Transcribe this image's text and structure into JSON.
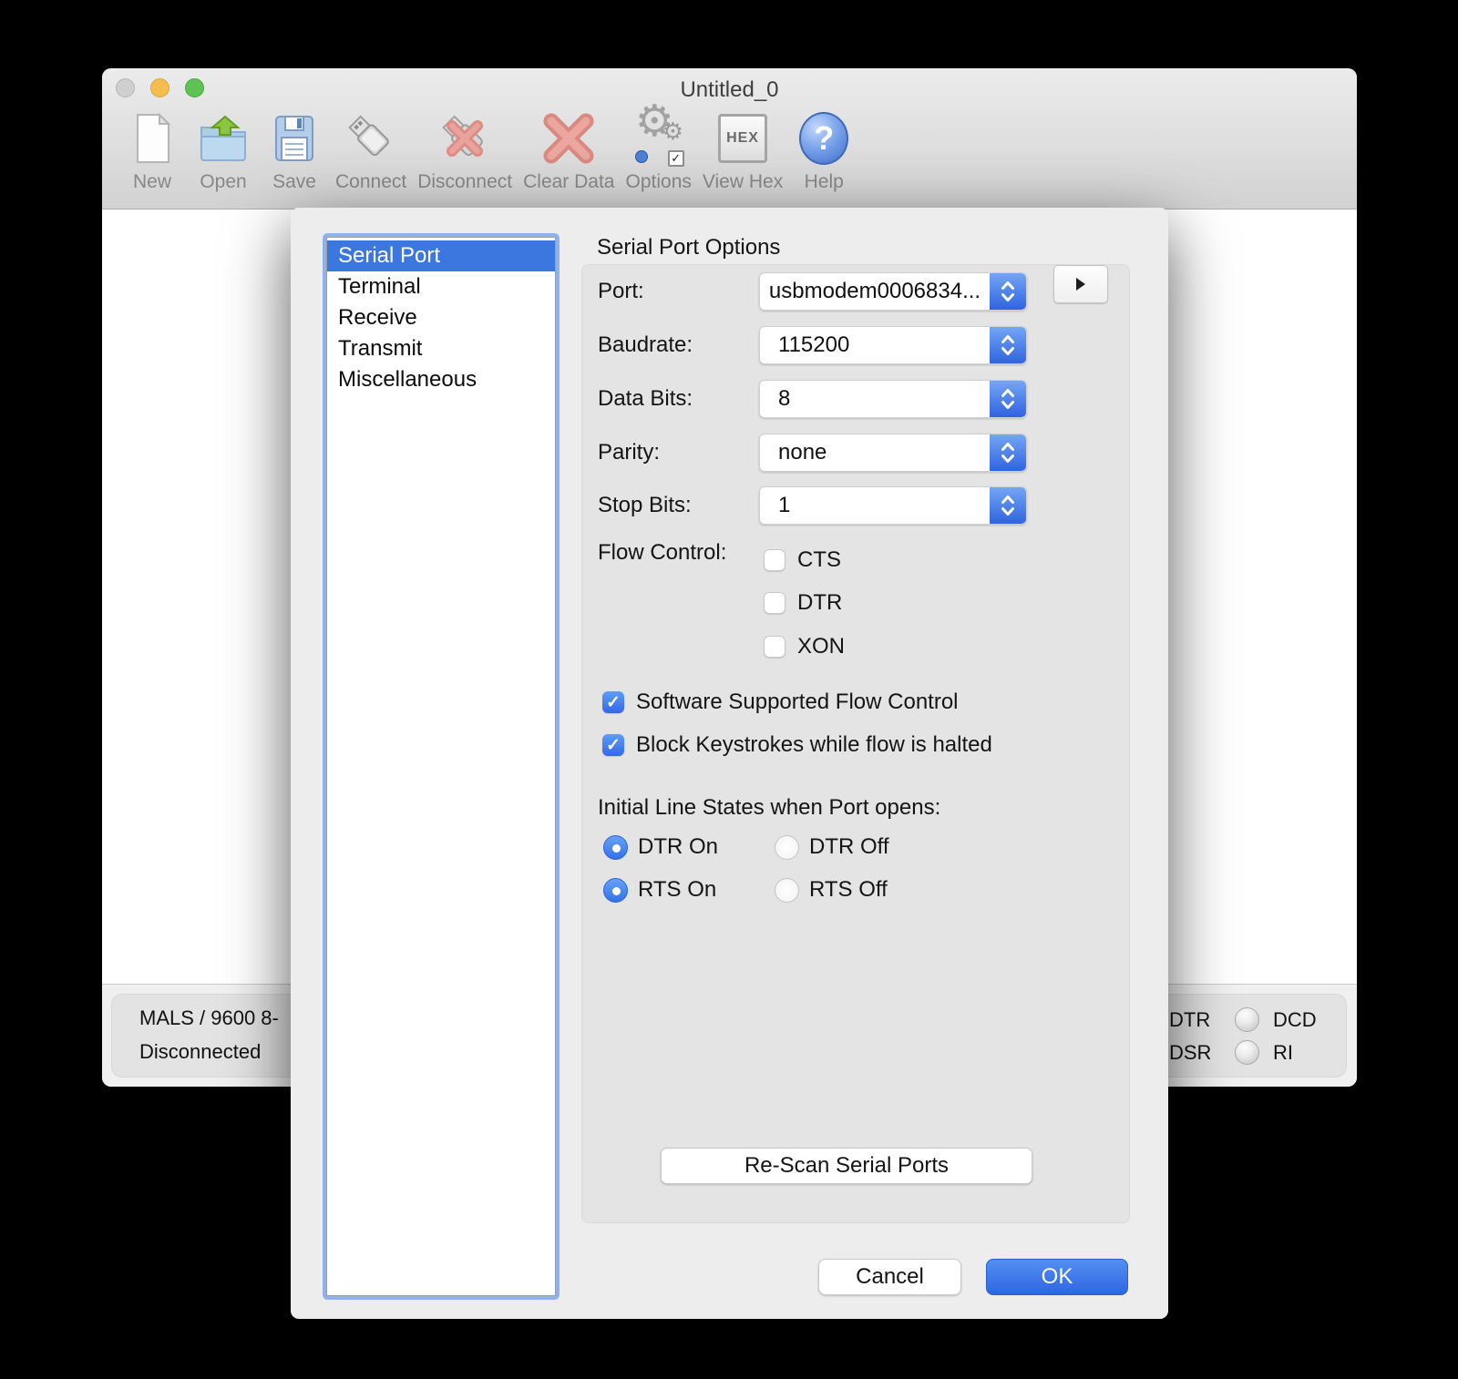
{
  "colors": {
    "selection_blue": "#3c77e0",
    "control_blue_top": "#74a6f5",
    "control_blue_bottom": "#3063e0",
    "ok_button_blue": "#2e66e3",
    "focus_ring_blue": "#8fb2ec",
    "traffic_close_gray": "#cfcfcf",
    "traffic_minimize_yellow": "#f6bd4e",
    "traffic_zoom_green": "#5ec353",
    "led_off_gray": "#cfcfcf"
  },
  "window": {
    "title": "Untitled_0",
    "toolbar": [
      {
        "label": "New"
      },
      {
        "label": "Open"
      },
      {
        "label": "Save"
      },
      {
        "label": "Connect"
      },
      {
        "label": "Disconnect"
      },
      {
        "label": "Clear Data"
      },
      {
        "label": "Options"
      },
      {
        "label": "View Hex",
        "icon_text": "HEX"
      },
      {
        "label": "Help",
        "icon_text": "?"
      }
    ],
    "status": {
      "line1": "MALS / 9600 8-",
      "line2": "Disconnected",
      "indicator_rows": [
        {
          "left": "DTR",
          "right": "DCD",
          "led": "off"
        },
        {
          "left": "DSR",
          "right": "RI",
          "led": "off"
        }
      ]
    }
  },
  "dialog": {
    "sidebar": {
      "items": [
        "Serial Port",
        "Terminal",
        "Receive",
        "Transmit",
        "Miscellaneous"
      ],
      "selected": "Serial Port"
    },
    "title": "Serial Port Options",
    "fields": [
      {
        "label": "Port:",
        "value": "usbmodem0006834..."
      },
      {
        "label": "Baudrate:",
        "value": "115200"
      },
      {
        "label": "Data Bits:",
        "value": "8"
      },
      {
        "label": "Parity:",
        "value": "none"
      },
      {
        "label": "Stop Bits:",
        "value": "1"
      }
    ],
    "flow_control": {
      "label": "Flow Control:",
      "options": [
        {
          "label": "CTS",
          "checked": false
        },
        {
          "label": "DTR",
          "checked": false
        },
        {
          "label": "XON",
          "checked": false
        }
      ]
    },
    "checkboxes": [
      {
        "label": "Software Supported Flow Control",
        "checked": true
      },
      {
        "label": "Block Keystrokes while flow is halted",
        "checked": true
      }
    ],
    "initial": {
      "label": "Initial Line States when Port opens:",
      "radios": [
        {
          "label": "DTR On",
          "selected": true
        },
        {
          "label": "DTR Off",
          "selected": false
        },
        {
          "label": "RTS On",
          "selected": true
        },
        {
          "label": "RTS Off",
          "selected": false
        }
      ]
    },
    "rescan_label": "Re-Scan Serial Ports",
    "cancel_label": "Cancel",
    "ok_label": "OK"
  }
}
